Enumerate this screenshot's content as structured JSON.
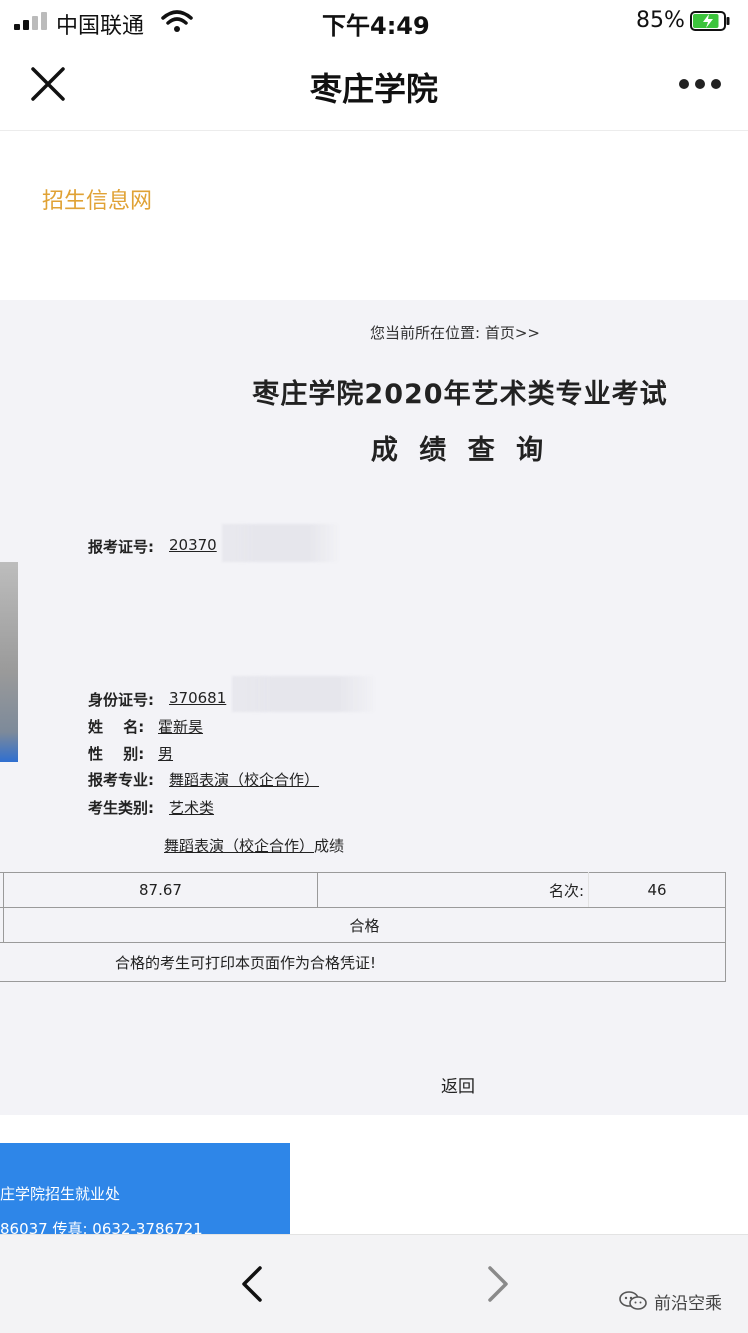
{
  "status_bar": {
    "carrier": "中国联通",
    "time": "下午4:49",
    "battery_percent": "85%",
    "icons": [
      "signal-icon",
      "wifi-icon",
      "battery-charging-icon"
    ],
    "battery_level": 0.85
  },
  "title_bar": {
    "title": "枣庄学院",
    "icons": [
      "close-icon",
      "more-icon"
    ]
  },
  "header": {
    "site_name": "招生信息网"
  },
  "page": {
    "breadcrumb": "您当前所在位置: 首页>>",
    "heading_line1": "枣庄学院2020年艺术类专业考试",
    "heading_line2": "成 绩 查 询",
    "fields": {
      "exam_id_label": "报考证号:",
      "exam_id_value": "20370",
      "id_card_label": "身份证号:",
      "id_card_value": "370681",
      "name_label": "姓　 名:",
      "name_value": "霍新昊",
      "gender_label": "性　 别:",
      "gender_value": "男",
      "major_label": "报考专业:",
      "major_value": "舞蹈表演（校企合作）",
      "category_label": "考生类别:",
      "category_value": "艺术类"
    },
    "score_caption_major": "舞蹈表演（校企合作）",
    "score_caption_suffix": "成绩",
    "score": "87.67",
    "rank_label": "名次:",
    "rank": "46",
    "result": "合格",
    "note": "合格的考生可打印本页面作为合格凭证!",
    "back_link": "返回"
  },
  "footer": {
    "line1": "庄学院招生就业处",
    "line2": "86037 传真: 0632-3786721"
  },
  "bottom_nav": {
    "icons": [
      "back-arrow-icon",
      "forward-arrow-icon",
      "wechat-official-icon"
    ],
    "watermark": "前沿空乘"
  },
  "colors": {
    "accent_orange": "#e0a235",
    "footer_blue": "#2e86e8",
    "content_bg": "#f3f3f7",
    "battery_green": "#3cc43c"
  }
}
